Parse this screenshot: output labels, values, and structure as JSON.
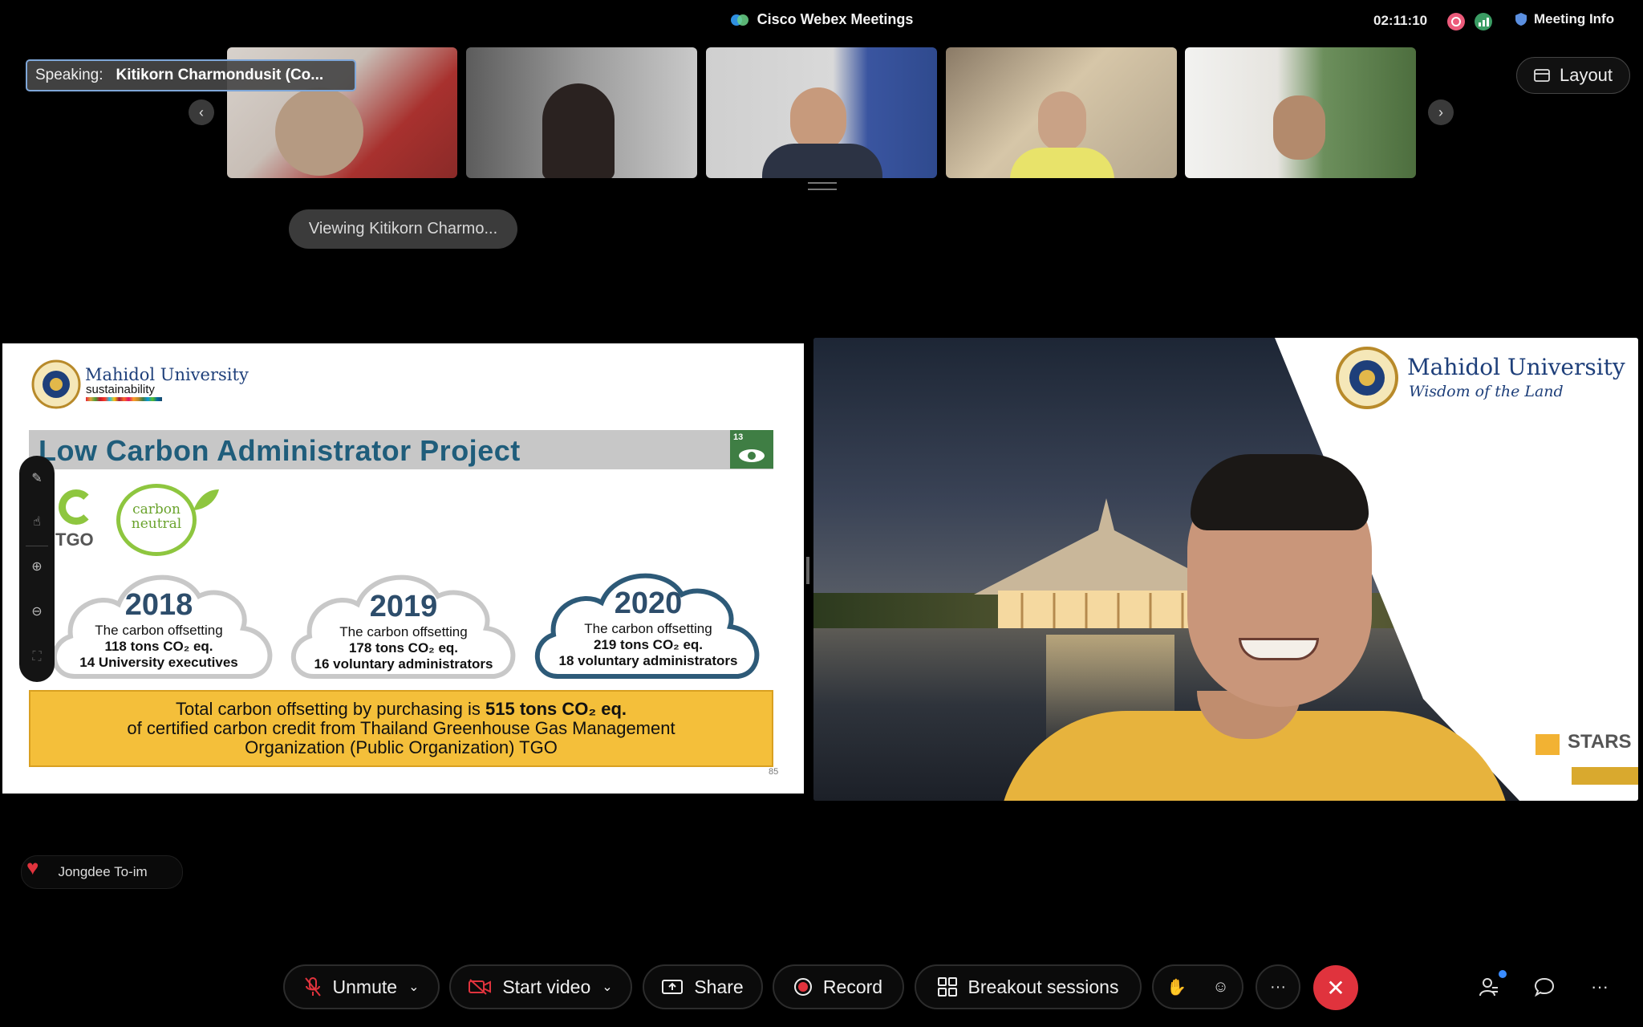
{
  "app": {
    "title": "Cisco Webex Meetings",
    "timer": "02:11:10",
    "meeting_info": "Meeting Info"
  },
  "speaking": {
    "label": "Speaking:",
    "name": "Kitikorn Charmondusit (Co..."
  },
  "layout_button": "Layout",
  "viewing": "Viewing Kitikorn Charmo...",
  "slide": {
    "logo_title": "Mahidol University",
    "logo_subtitle": "sustainability",
    "heading": "Low Carbon Administrator Project",
    "sdg_badge": "13",
    "tgo_logo_text": "TGO",
    "carbon_neutral_logo": [
      "carbon",
      "neutral"
    ],
    "clouds": [
      {
        "year": "2018",
        "line1": "The carbon offsetting",
        "line2": "118 tons CO₂ eq.",
        "line3": "14 University executives"
      },
      {
        "year": "2019",
        "line1": "The carbon offsetting",
        "line2": "178 tons CO₂ eq.",
        "line3": "16 voluntary administrators"
      },
      {
        "year": "2020",
        "line1": "The carbon offsetting",
        "line2": "219 tons CO₂ eq.",
        "line3": "18 voluntary administrators"
      }
    ],
    "total": {
      "prefix": "Total carbon offsetting by purchasing is ",
      "amount": "515 tons CO₂ eq.",
      "line2": "of certified carbon credit from Thailand Greenhouse Gas Management",
      "line3": "Organization (Public Organization) TGO"
    },
    "page_number": "85"
  },
  "video": {
    "brand_title": "Mahidol University",
    "brand_motto": "Wisdom of the Land",
    "stars_label": "STARS"
  },
  "reaction": {
    "name": "Jongdee To-im"
  },
  "controls": {
    "unmute": "Unmute",
    "start_video": "Start video",
    "share": "Share",
    "record": "Record",
    "breakout": "Breakout sessions",
    "more": "···"
  },
  "colors": {
    "end_call": "#e0333d",
    "record_dot": "#ec5a7a",
    "signal": "#3a9c63",
    "slide_banner_text": "#1f5d7b",
    "total_box": "#f4bf3a"
  }
}
